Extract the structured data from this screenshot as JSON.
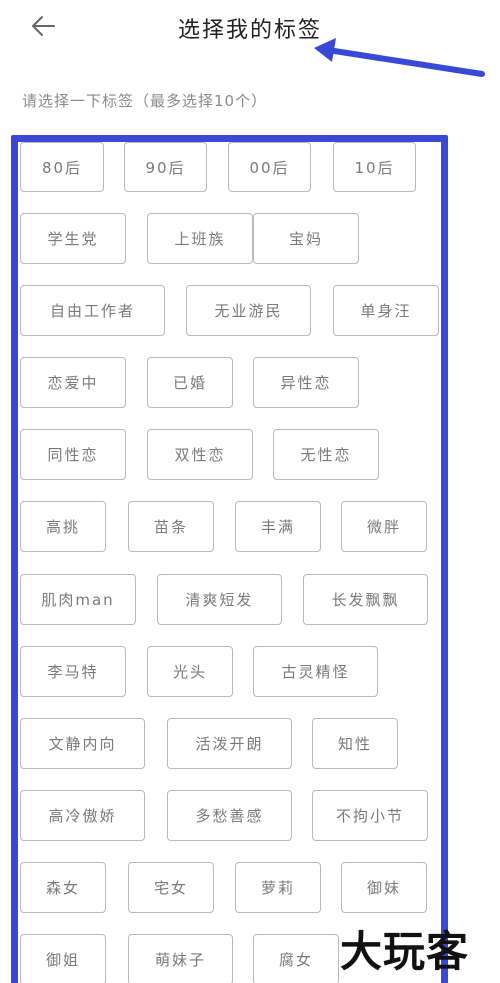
{
  "header": {
    "title": "选择我的标签",
    "back_icon": "back-arrow-icon"
  },
  "hint": "请选择一下标签（最多选择10个）",
  "annotation": {
    "arrow_color": "#3a48d8",
    "frame_color": "#3a48d8"
  },
  "tags": [
    "80后",
    "90后",
    "00后",
    "10后",
    "学生党",
    "上班族",
    "宝妈",
    "自由工作者",
    "无业游民",
    "单身汪",
    "恋爱中",
    "已婚",
    "异性恋",
    "同性恋",
    "双性恋",
    "无性恋",
    "高挑",
    "苗条",
    "丰满",
    "微胖",
    "肌肉man",
    "清爽短发",
    "长发飘飘",
    "李马特",
    "光头",
    "古灵精怪",
    "文静内向",
    "活泼开朗",
    "知性",
    "高冷傲娇",
    "多愁善感",
    "不拘小节",
    "森女",
    "宅女",
    "萝莉",
    "御妹",
    "御姐",
    "萌妹子",
    "腐女"
  ],
  "watermark": "大玩客"
}
